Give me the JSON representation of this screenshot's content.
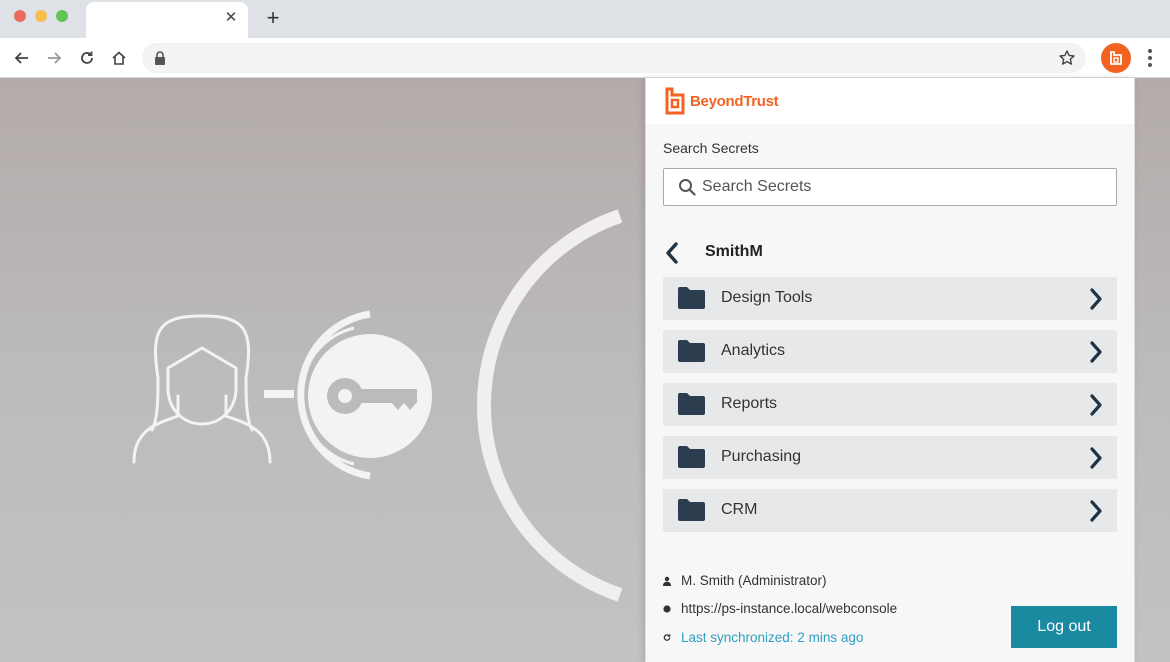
{
  "browser": {
    "tab_close_glyph": "✕",
    "new_tab_glyph": "+"
  },
  "popup": {
    "brand_name": "BeyondTrust",
    "search_label": "Search Secrets",
    "search_placeholder": "Search Secrets",
    "search_value": "",
    "current_folder": "SmithM",
    "folders": [
      {
        "label": "Design Tools"
      },
      {
        "label": "Analytics"
      },
      {
        "label": "Reports"
      },
      {
        "label": "Purchasing"
      },
      {
        "label": "CRM"
      }
    ],
    "user": "M. Smith (Administrator)",
    "instance_url": "https://ps-instance.local/webconsole",
    "last_sync": "Last synchronized: 2 mins ago",
    "logout_label": "Log out"
  },
  "colors": {
    "brand_orange": "#f26322",
    "logout_teal": "#1a8aa1",
    "sync_blue": "#2fa0c0",
    "folder_icon": "#2b3d4f"
  }
}
